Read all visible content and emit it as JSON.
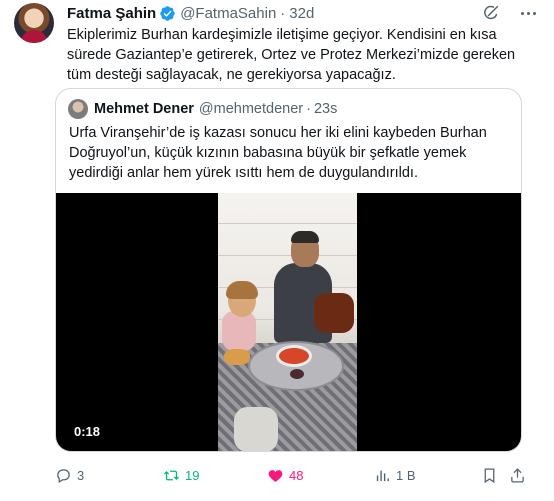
{
  "post": {
    "author_name": "Fatma Şahin",
    "author_handle": "@FatmaSahin",
    "separator": "·",
    "time": "32d",
    "text": "Ekiplerimiz Burhan kardeşimizle iletişime geçiyor. Kendisini en kısa sürede Gaziantep’e getirerek, Ortez ve Protez Merkezi’mizde gereken tüm desteği sağlayacak, ne gerekiyorsa yapacağız.",
    "verified_icon": "verified-badge-icon",
    "avatar_icon": "avatar"
  },
  "quote": {
    "author_name": "Mehmet Dener",
    "author_handle": "@mehmetdener",
    "separator": "·",
    "time": "23s",
    "text": "Urfa Viranşehir’de iş kazası sonucu her iki elini kaybeden Burhan Doğruyol’un, küçük kızının babasına büyük bir şefkatle yemek yedirdiği anlar hem yürek ısıttı hem de duygulandırıldı.",
    "video_duration": "0:18"
  },
  "actions": {
    "replies": "3",
    "retweets": "19",
    "likes": "48",
    "views": "1 B"
  },
  "colors": {
    "text": "#0f1419",
    "muted": "#536471",
    "verified": "#1d9bf0",
    "retweet": "#00ba7c",
    "like": "#f91880",
    "border": "#cfd9de"
  }
}
